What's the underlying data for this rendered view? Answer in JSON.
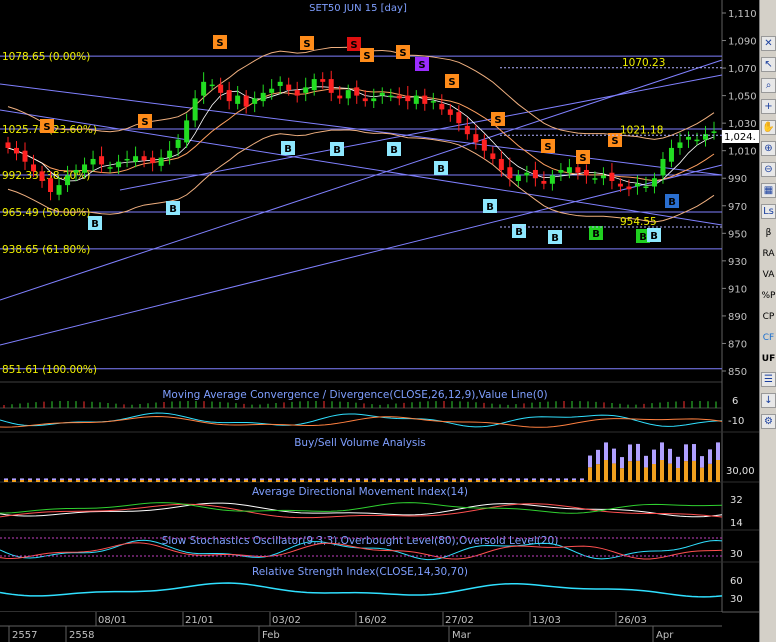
{
  "title": "SET50 JUN 15   [day]",
  "colors": {
    "background": "#000000",
    "price_axis_text": "#c0c0c0",
    "fib_text": "#f0f000",
    "panel_title": "#7f9fff",
    "sell_marker": "#ff8c1a",
    "buy_marker": "#8ee8ff",
    "buy_marker_green": "#20d020",
    "buy_marker_blue": "#2a6fd0",
    "sell_marker_red": "#e01010",
    "sell_marker_purple": "#9a2cff",
    "candle_up": "#22dd22",
    "candle_down": "#ff2222",
    "bollinger": "#f0b080",
    "trend_lines": "#8080ff"
  },
  "price_axis": {
    "labels": [
      "1,110",
      "1,090",
      "1,070",
      "1,050",
      "1,030",
      "1,010",
      "990",
      "970",
      "950",
      "930",
      "910",
      "890",
      "870",
      "850"
    ],
    "values": [
      1110,
      1090,
      1070,
      1050,
      1030,
      1010,
      990,
      970,
      950,
      930,
      910,
      890,
      870,
      850
    ],
    "last_price_label": "1,024."
  },
  "fib_levels": [
    {
      "label": "1078.65 (0.00%)",
      "price": 1078.65
    },
    {
      "label": "1025.78 (23.60%)",
      "price": 1025.78
    },
    {
      "label": "992.33 (38.20%)",
      "price": 992.33
    },
    {
      "label": "965.49 (50.00%)",
      "price": 965.49
    },
    {
      "label": "938.65 (61.80%)",
      "price": 938.65
    },
    {
      "label": "851.61 (100.00%)",
      "price": 851.61
    }
  ],
  "annotations": [
    {
      "label": "1070.23",
      "price": 1070.23
    },
    {
      "label": "1021.18",
      "price": 1021.18
    },
    {
      "label": "954.55",
      "price": 954.55
    }
  ],
  "panels": {
    "macd": {
      "title": "Moving Average Convergence / Divergence(CLOSE,26,12,9),Value Line(0)",
      "axis": [
        "6",
        "-10"
      ]
    },
    "volume": {
      "title": "Buy/Sell Volume Analysis",
      "axis": [
        "30,00"
      ]
    },
    "adx": {
      "title": "Average Directional Movement Index(14)",
      "axis": [
        "32",
        "14"
      ]
    },
    "stoch": {
      "title": "Slow Stochastics Oscillator(9,3,3),Overbought Level(80),Oversold Level(20)",
      "axis": [
        "30"
      ]
    },
    "rsi": {
      "title": "Relative Strength Index(CLOSE,14,30,70)",
      "axis": [
        "60",
        "30"
      ]
    }
  },
  "date_axis": {
    "top_labels": [
      "08/01",
      "21/01",
      "03/02",
      "16/02",
      "27/02",
      "13/03",
      "26/03"
    ],
    "bottom_labels": [
      "2557",
      "2558",
      "Feb",
      "Mar",
      "Apr"
    ]
  },
  "markers": {
    "sell_letter": "S",
    "buy_letter": "B"
  },
  "toolbar": {
    "items": [
      {
        "name": "toolbar-close-icon",
        "glyph": "✕",
        "kind": "icon"
      },
      {
        "name": "toolbar-arrow-icon",
        "glyph": "↖",
        "kind": "icon"
      },
      {
        "name": "toolbar-zoom-icon",
        "glyph": "⌕",
        "kind": "icon"
      },
      {
        "name": "toolbar-crosshair-icon",
        "glyph": "+",
        "kind": "icon"
      },
      {
        "name": "toolbar-pan-icon",
        "glyph": "✋",
        "kind": "icon"
      },
      {
        "name": "toolbar-zoom-in-icon",
        "glyph": "⊕",
        "kind": "icon"
      },
      {
        "name": "toolbar-zoom-out-icon",
        "glyph": "⊖",
        "kind": "icon"
      },
      {
        "name": "toolbar-grid-icon",
        "glyph": "▦",
        "kind": "icon"
      },
      {
        "name": "toolbar-ls-icon",
        "glyph": "Ls",
        "kind": "icon"
      },
      {
        "name": "toolbar-beta",
        "glyph": "β",
        "kind": "text"
      },
      {
        "name": "toolbar-ra",
        "glyph": "RA",
        "kind": "text"
      },
      {
        "name": "toolbar-va",
        "glyph": "VA",
        "kind": "text"
      },
      {
        "name": "toolbar-pctp",
        "glyph": "%P",
        "kind": "text"
      },
      {
        "name": "toolbar-cp",
        "glyph": "CP",
        "kind": "text"
      },
      {
        "name": "toolbar-cf",
        "glyph": "CF",
        "kind": "text"
      },
      {
        "name": "toolbar-uf",
        "glyph": "UF",
        "kind": "text"
      },
      {
        "name": "toolbar-list-icon",
        "glyph": "☰",
        "kind": "icon"
      },
      {
        "name": "toolbar-down-icon",
        "glyph": "↓",
        "kind": "icon"
      },
      {
        "name": "toolbar-settings-icon",
        "glyph": "⚙",
        "kind": "icon"
      }
    ]
  }
}
